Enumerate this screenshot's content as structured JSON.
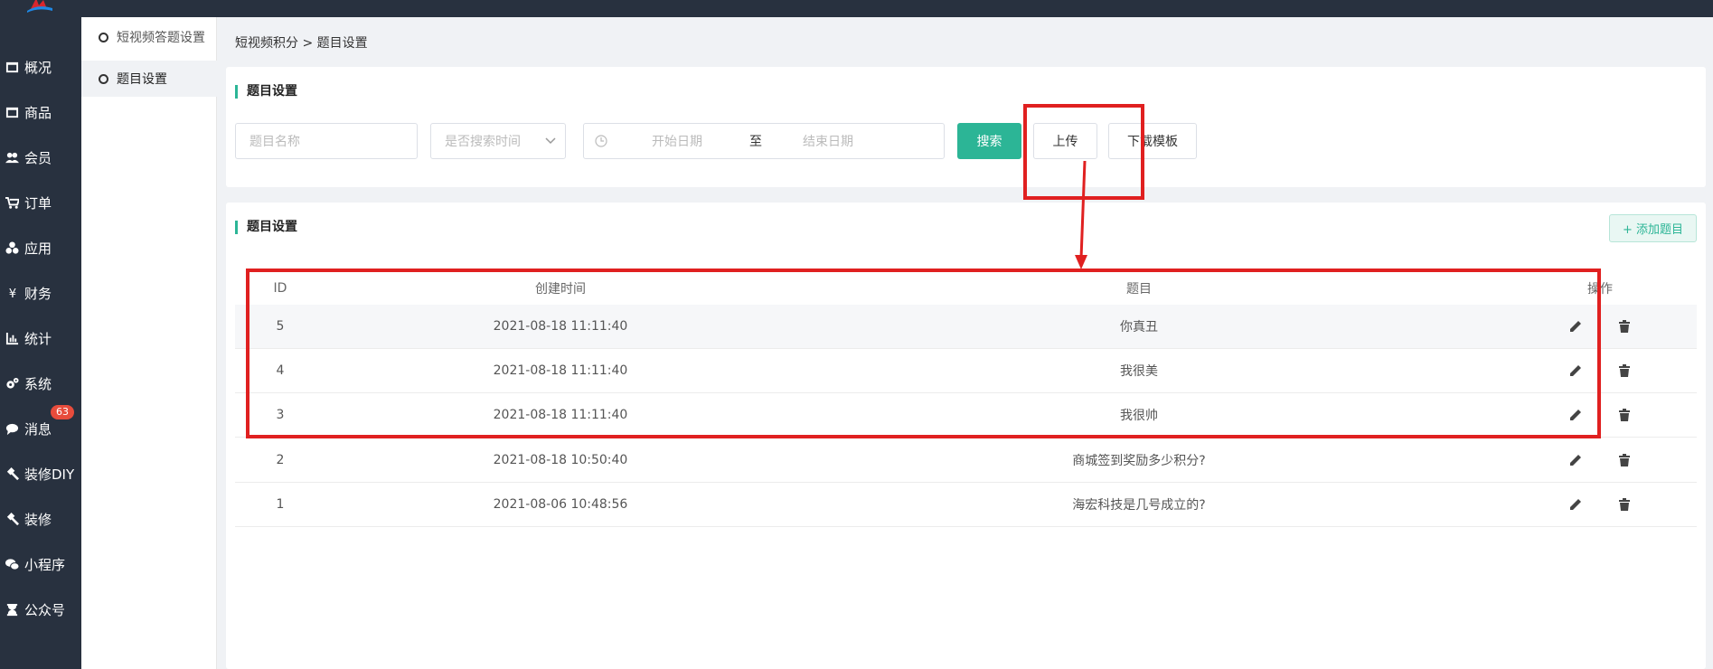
{
  "nav": {
    "items": [
      {
        "label": "概况",
        "icon": "overview-icon"
      },
      {
        "label": "商品",
        "icon": "goods-icon"
      },
      {
        "label": "会员",
        "icon": "members-icon"
      },
      {
        "label": "订单",
        "icon": "cart-icon"
      },
      {
        "label": "应用",
        "icon": "apps-icon"
      },
      {
        "label": "财务",
        "icon": "yen-icon"
      },
      {
        "label": "统计",
        "icon": "bar-chart-icon"
      },
      {
        "label": "系统",
        "icon": "gears-icon"
      },
      {
        "label": "消息",
        "icon": "comment-icon",
        "badge": "63"
      },
      {
        "label": "装修DIY",
        "icon": "hammer-icon"
      },
      {
        "label": "装修",
        "icon": "hammer-icon"
      },
      {
        "label": "小程序",
        "icon": "wechat-icon"
      },
      {
        "label": "公众号",
        "icon": "hourglass-icon"
      }
    ]
  },
  "subnav": {
    "items": [
      {
        "label": "短视频答题设置"
      },
      {
        "label": "题目设置"
      }
    ]
  },
  "breadcrumb": "短视频积分 > 题目设置",
  "filter": {
    "title": "题目设置",
    "name_placeholder": "题目名称",
    "search_time_placeholder": "是否搜索时间",
    "start_placeholder": "开始日期",
    "range_sep": "至",
    "end_placeholder": "结束日期",
    "search_label": "搜索",
    "upload_label": "上传",
    "download_label": "下载模板"
  },
  "list": {
    "title": "题目设置",
    "add_label": "+ 添加题目",
    "columns": [
      "ID",
      "创建时间",
      "题目",
      "操作"
    ],
    "rows": [
      {
        "id": "5",
        "time": "2021-08-18 11:11:40",
        "title": "你真丑"
      },
      {
        "id": "4",
        "time": "2021-08-18 11:11:40",
        "title": "我很美"
      },
      {
        "id": "3",
        "time": "2021-08-18 11:11:40",
        "title": "我很帅"
      },
      {
        "id": "2",
        "time": "2021-08-18 10:50:40",
        "title": "商城签到奖励多少积分?"
      },
      {
        "id": "1",
        "time": "2021-08-06 10:48:56",
        "title": "海宏科技是几号成立的?"
      }
    ]
  },
  "colors": {
    "accent": "#2cb596",
    "nav_bg": "#28313f",
    "annotation": "#e02020",
    "badge": "#e74c3c"
  }
}
